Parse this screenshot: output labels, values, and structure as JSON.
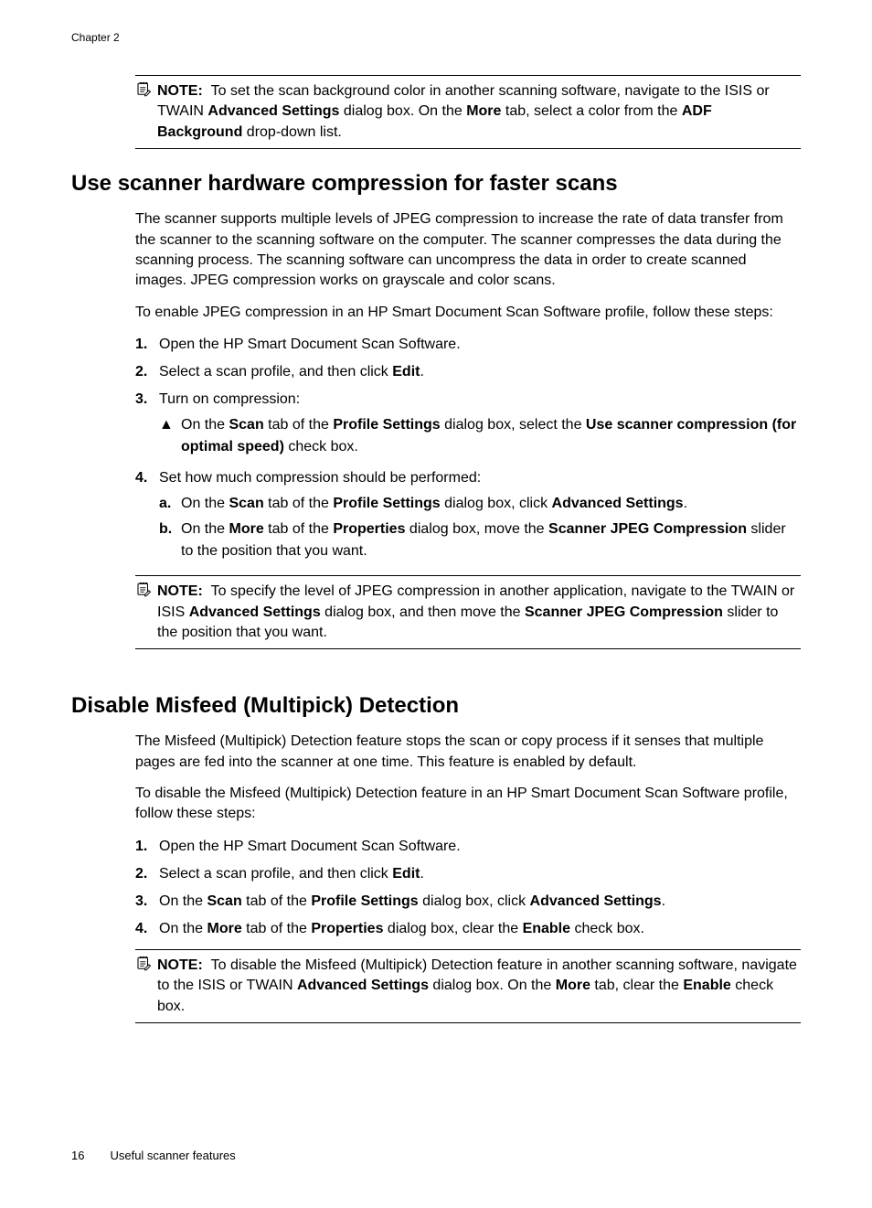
{
  "chapterHeader": "Chapter 2",
  "noteLabel": "NOTE:",
  "note1": {
    "seg1": "To set the scan background color in another scanning software, navigate to the ISIS or TWAIN ",
    "b1": "Advanced Settings",
    "seg2": " dialog box. On the ",
    "b2": "More",
    "seg3": " tab, select a color from the ",
    "b3": "ADF Background",
    "seg4": " drop-down list."
  },
  "section1": {
    "heading": "Use scanner hardware compression for faster scans",
    "p1": "The scanner supports multiple levels of JPEG compression to increase the rate of data transfer from the scanner to the scanning software on the computer. The scanner compresses the data during the scanning process. The scanning software can uncompress the data in order to create scanned images. JPEG compression works on grayscale and color scans.",
    "p2": "To enable JPEG compression in an HP Smart Document Scan Software profile, follow these steps:",
    "li1": "Open the HP Smart Document Scan Software.",
    "li2_a": "Select a scan profile, and then click ",
    "li2_b": "Edit",
    "li2_c": ".",
    "li3": "Turn on compression:",
    "li3_sub_a1": "On the ",
    "li3_sub_b1": "Scan",
    "li3_sub_a2": " tab of the ",
    "li3_sub_b2": "Profile Settings",
    "li3_sub_a3": " dialog box, select the ",
    "li3_sub_b3": "Use scanner compression (for optimal speed)",
    "li3_sub_a4": " check box.",
    "li4": "Set how much compression should be performed:",
    "li4a_1": "On the ",
    "li4a_b1": "Scan",
    "li4a_2": " tab of the ",
    "li4a_b2": "Profile Settings",
    "li4a_3": " dialog box, click ",
    "li4a_b3": "Advanced Settings",
    "li4a_4": ".",
    "li4b_1": "On the ",
    "li4b_b1": "More",
    "li4b_2": " tab of the ",
    "li4b_b2": "Properties",
    "li4b_3": " dialog box, move the ",
    "li4b_b3": "Scanner JPEG Compression",
    "li4b_4": " slider to the position that you want.",
    "note_1": "To specify the level of JPEG compression in another application, navigate to the TWAIN or ISIS ",
    "note_b1": "Advanced Settings",
    "note_2": " dialog box, and then move the ",
    "note_b2": "Scanner JPEG Compression",
    "note_3": " slider to the position that you want."
  },
  "section2": {
    "heading": "Disable Misfeed (Multipick) Detection",
    "p1": "The Misfeed (Multipick) Detection feature stops the scan or copy process if it senses that multiple pages are fed into the scanner at one time. This feature is enabled by default.",
    "p2": "To disable the Misfeed (Multipick) Detection feature in an HP Smart Document Scan Software profile, follow these steps:",
    "li1": "Open the HP Smart Document Scan Software.",
    "li2_a": "Select a scan profile, and then click ",
    "li2_b": "Edit",
    "li2_c": ".",
    "li3_1": "On the ",
    "li3_b1": "Scan",
    "li3_2": " tab of the ",
    "li3_b2": "Profile Settings",
    "li3_3": " dialog box, click ",
    "li3_b3": "Advanced Settings",
    "li3_4": ".",
    "li4_1": "On the ",
    "li4_b1": "More",
    "li4_2": " tab of the ",
    "li4_b2": "Properties",
    "li4_3": " dialog box, clear the ",
    "li4_b3": "Enable",
    "li4_4": " check box.",
    "note_1": "To disable the Misfeed (Multipick) Detection feature in another scanning software, navigate to the ISIS or TWAIN ",
    "note_b1": "Advanced Settings",
    "note_2": " dialog box. On the ",
    "note_b2": "More",
    "note_3": " tab, clear the ",
    "note_b3": "Enable",
    "note_4": " check box."
  },
  "footer": {
    "pageNum": "16",
    "title": "Useful scanner features"
  },
  "nums": {
    "n1": "1.",
    "n2": "2.",
    "n3": "3.",
    "n4": "4."
  },
  "letters": {
    "a": "a",
    "b": "b"
  },
  "period": ".",
  "triangle": "▲"
}
